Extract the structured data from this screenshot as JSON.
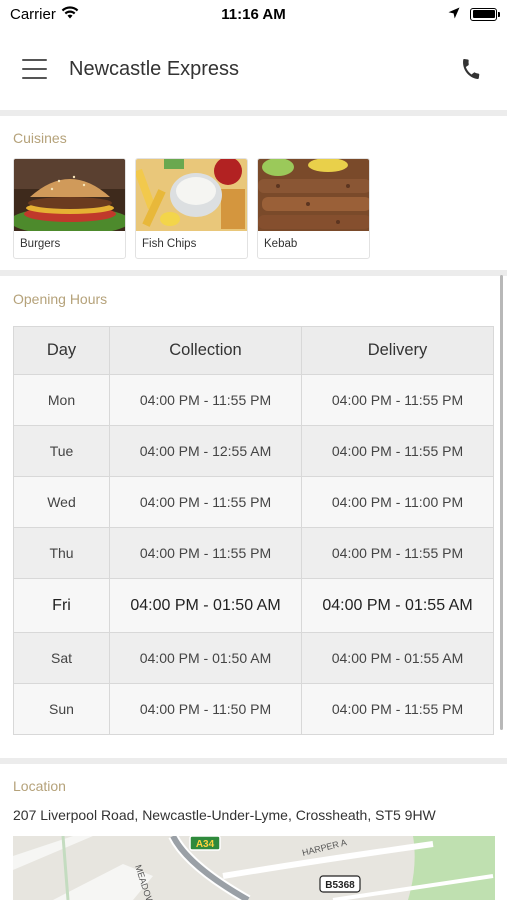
{
  "status_bar": {
    "carrier": "Carrier",
    "time": "11:16 AM"
  },
  "header": {
    "title": "Newcastle Express"
  },
  "cuisines": {
    "label": "Cuisines",
    "items": [
      {
        "name": "Burgers"
      },
      {
        "name": "Fish  Chips"
      },
      {
        "name": "Kebab"
      }
    ]
  },
  "opening_hours": {
    "label": "Opening Hours",
    "columns": [
      "Day",
      "Collection",
      "Delivery"
    ],
    "rows": [
      {
        "day": "Mon",
        "collection": "04:00 PM - 11:55 PM",
        "delivery": "04:00 PM - 11:55 PM"
      },
      {
        "day": "Tue",
        "collection": "04:00 PM - 12:55 AM",
        "delivery": "04:00 PM - 11:55 PM"
      },
      {
        "day": "Wed",
        "collection": "04:00 PM - 11:55 PM",
        "delivery": "04:00 PM - 11:00 PM"
      },
      {
        "day": "Thu",
        "collection": "04:00 PM - 11:55 PM",
        "delivery": "04:00 PM - 11:55 PM"
      },
      {
        "day": "Fri",
        "collection": "04:00 PM - 01:50 AM",
        "delivery": "04:00 PM - 01:55 AM",
        "today": true
      },
      {
        "day": "Sat",
        "collection": "04:00 PM - 01:50 AM",
        "delivery": "04:00 PM - 01:55 AM"
      },
      {
        "day": "Sun",
        "collection": "04:00 PM - 11:50 PM",
        "delivery": "04:00 PM - 11:55 PM"
      }
    ]
  },
  "location": {
    "label": "Location",
    "address": "207 Liverpool Road, Newcastle-Under-Lyme, Crossheath, ST5 9HW",
    "map": {
      "road_a": "A34",
      "road_b": "B5368",
      "street_1": "HARPER A",
      "street_2": "MEADOW"
    }
  },
  "colors": {
    "section_label": "#b5a27a",
    "divider": "#ececec",
    "table_header": "#ececec",
    "road_sign_green": "#2f8a3c"
  },
  "icons": {
    "menu": "hamburger-icon",
    "phone": "phone-icon",
    "wifi": "wifi-icon",
    "location": "location-arrow-icon",
    "battery": "battery-icon"
  }
}
